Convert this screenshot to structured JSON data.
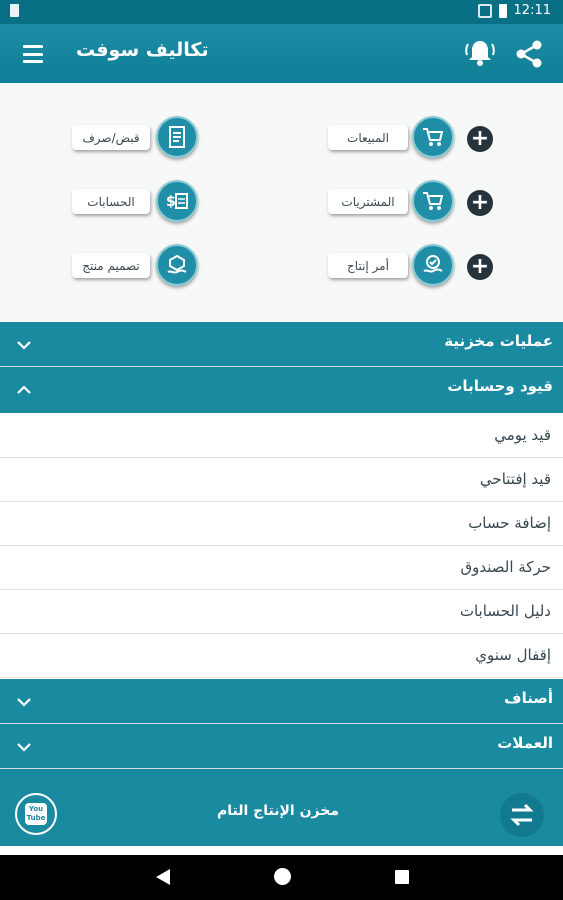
{
  "status": {
    "time": "12:11"
  },
  "app": {
    "title": "تكاليف سوفت"
  },
  "grid": {
    "tiles": [
      {
        "label": "المبيعات",
        "icon": "cart-icon"
      },
      {
        "label": "قبض/صرف",
        "icon": "receipt-icon"
      },
      {
        "label": "المشتريات",
        "icon": "cart-icon"
      },
      {
        "label": "الحسابات",
        "icon": "money-icon"
      },
      {
        "label": "أمر إنتاج",
        "icon": "production-icon"
      },
      {
        "label": "تصميم منتج",
        "icon": "product-design-icon"
      }
    ]
  },
  "sections": [
    {
      "label": "عمليات مخزنية",
      "expanded": false
    },
    {
      "label": "قيود وحسابات",
      "expanded": true,
      "items": [
        "قيد يومي",
        "قيد إفتتاحي",
        "إضافة حساب",
        "حركة الصندوق",
        "دليل الحسابات",
        "إقفال سنوي"
      ]
    },
    {
      "label": "أصناف",
      "expanded": false
    },
    {
      "label": "العملات",
      "expanded": false
    }
  ],
  "banner": {
    "title": "مخزن الإنتاج التام",
    "youtube": [
      "You",
      "Tube"
    ]
  },
  "colors": {
    "primary": "#1a8aa1",
    "statusbar": "#086f84",
    "dark": "#27333a"
  }
}
